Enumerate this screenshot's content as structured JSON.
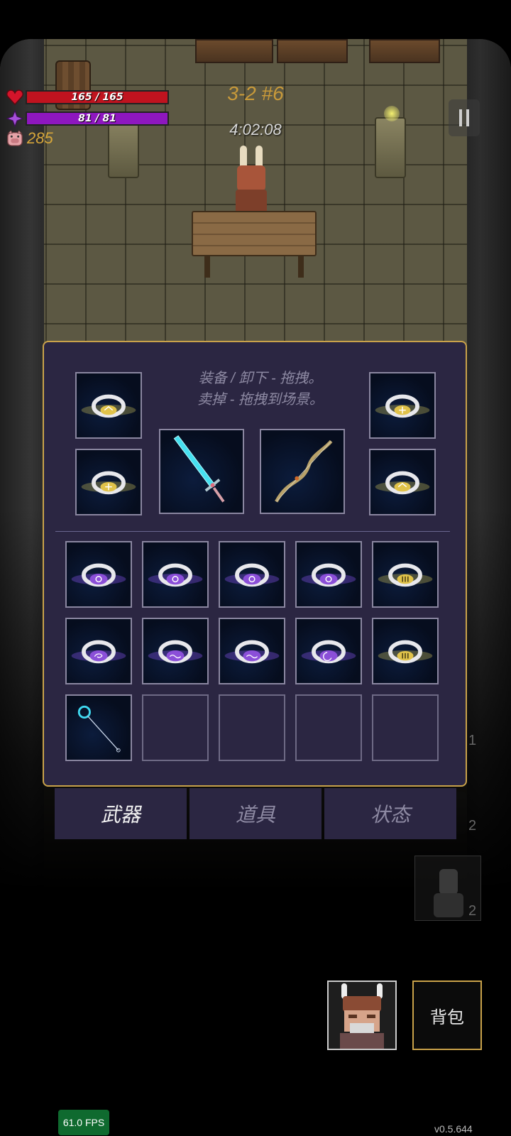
{
  "hud": {
    "hp": "165 / 165",
    "mp": "81 / 81",
    "gold": "285",
    "stage": "3-2 #6",
    "timer": "4:02:08",
    "icons": {
      "hp": "heart-icon",
      "mp": "mana-crystal-icon",
      "gold": "pig-icon"
    }
  },
  "inventory": {
    "hint_line1": "装备 / 卸下 - 拖拽。",
    "hint_line2": "卖掉 - 拖拽到场景。",
    "equipped": [
      {
        "name": "ring-gold-gem",
        "kind": "ring"
      },
      {
        "name": "ring-gold-cross",
        "kind": "ring"
      },
      {
        "name": "ring-gold-cross",
        "kind": "ring"
      },
      {
        "name": "ring-gold-gem",
        "kind": "ring"
      },
      {
        "name": "cyan-sword",
        "kind": "weapon"
      },
      {
        "name": "golden-bow",
        "kind": "weapon"
      }
    ],
    "grid": [
      {
        "kind": "ring",
        "gem": "flower",
        "color": "purple"
      },
      {
        "kind": "ring",
        "gem": "flower",
        "color": "purple"
      },
      {
        "kind": "ring",
        "gem": "flower",
        "color": "purple"
      },
      {
        "kind": "ring",
        "gem": "flower",
        "color": "purple"
      },
      {
        "kind": "ring",
        "gem": "bars",
        "color": "gold"
      },
      {
        "kind": "ring",
        "gem": "swirl",
        "color": "purple"
      },
      {
        "kind": "ring",
        "gem": "wave",
        "color": "purple"
      },
      {
        "kind": "ring",
        "gem": "wave",
        "color": "purple"
      },
      {
        "kind": "ring",
        "gem": "moon",
        "color": "purple"
      },
      {
        "kind": "ring",
        "gem": "bars",
        "color": "gold"
      },
      {
        "kind": "wand",
        "color": "cyan"
      },
      {
        "kind": "empty"
      },
      {
        "kind": "empty"
      },
      {
        "kind": "empty"
      },
      {
        "kind": "empty"
      }
    ]
  },
  "tabs": [
    {
      "label": "武器",
      "active": true
    },
    {
      "label": "道具",
      "active": false
    },
    {
      "label": "状态",
      "active": false
    }
  ],
  "edge_numbers": [
    "1",
    "2",
    "2"
  ],
  "bag_button": "背包",
  "fps": "61.0 FPS",
  "version": "v0.5.644",
  "colors": {
    "panel": "#2b2642",
    "panel_border": "#c9a24a",
    "hp": "#c0131f",
    "mp": "#8e17bf",
    "gold": "#d6a63a"
  }
}
